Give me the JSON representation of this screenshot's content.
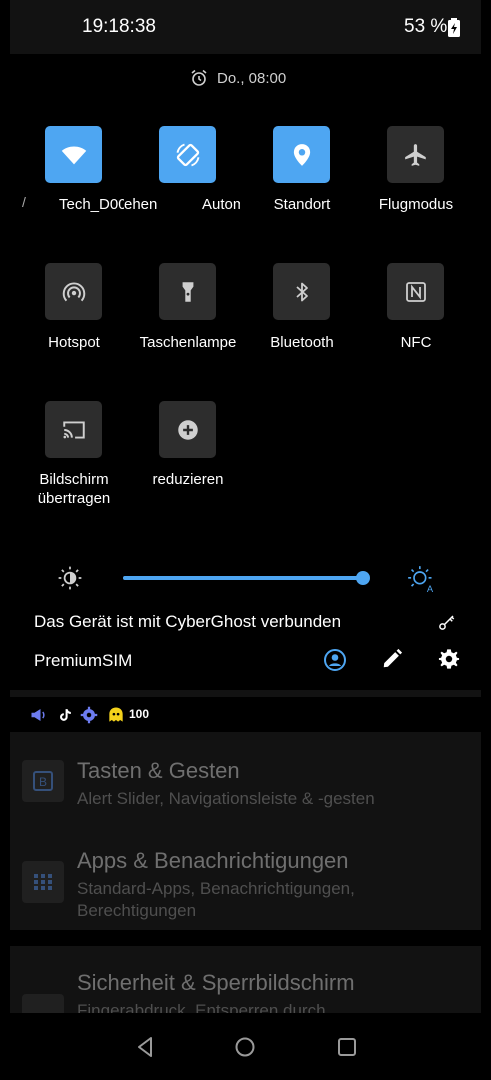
{
  "status_bar": {
    "time": "19:18:38",
    "battery": "53 %"
  },
  "alarm": {
    "text": "Do., 08:00",
    "icon": "alarm-clock-icon"
  },
  "tiles_row1": [
    {
      "label": "Tech_D00",
      "icon": "wifi-icon",
      "active": true
    },
    {
      "label": "Autom",
      "icon": "auto-rotate-icon",
      "active": true
    },
    {
      "label": "Standort",
      "icon": "location-pin-icon",
      "active": true
    },
    {
      "label": "Flugmodus",
      "icon": "airplane-icon",
      "active": false
    }
  ],
  "tiles_row1_ghost": {
    "left": "ehen"
  },
  "tiles_row2": [
    {
      "label": "Hotspot",
      "icon": "hotspot-icon",
      "active": false
    },
    {
      "label": "Taschenlampe",
      "icon": "flashlight-icon",
      "active": false
    },
    {
      "label": "Bluetooth",
      "icon": "bluetooth-icon",
      "active": false
    },
    {
      "label": "NFC",
      "icon": "nfc-icon",
      "active": false
    }
  ],
  "tiles_row3": [
    {
      "label": "Bildschirm übertragen",
      "icon": "cast-icon",
      "active": false
    },
    {
      "label": "reduzieren",
      "icon": "data-saver-icon",
      "active": false
    }
  ],
  "brightness": {
    "level": 1.0,
    "accent": "#4ea6f2"
  },
  "vpn": {
    "text": "Das Gerät ist mit CyberGhost verbunden",
    "icon": "key-icon"
  },
  "footer": {
    "carrier": "PremiumSIM",
    "icons": [
      "user-icon",
      "edit-icon",
      "settings-icon"
    ]
  },
  "notifications": {
    "count": "100",
    "icons": [
      "megaphone-icon",
      "tiktok-icon",
      "gear-badge-icon",
      "cyberghost-icon"
    ]
  },
  "settings_list": [
    {
      "title": "Tasten & Gesten",
      "subtitle": "Alert Slider, Navigationsleiste & -gesten",
      "icon": "button-icon"
    },
    {
      "title": "Apps & Benachrichtigungen",
      "subtitle": "Standard-Apps, Benachrichtigungen, Berechtigungen",
      "icon": "apps-grid-icon"
    },
    {
      "title": "Sicherheit & Sperrbildschirm",
      "subtitle": "Fingerabdruck, Entsperren durch",
      "icon": "lock-icon"
    }
  ],
  "colors": {
    "accent": "#4ea6f2",
    "tile_off": "#2d2d2d"
  }
}
